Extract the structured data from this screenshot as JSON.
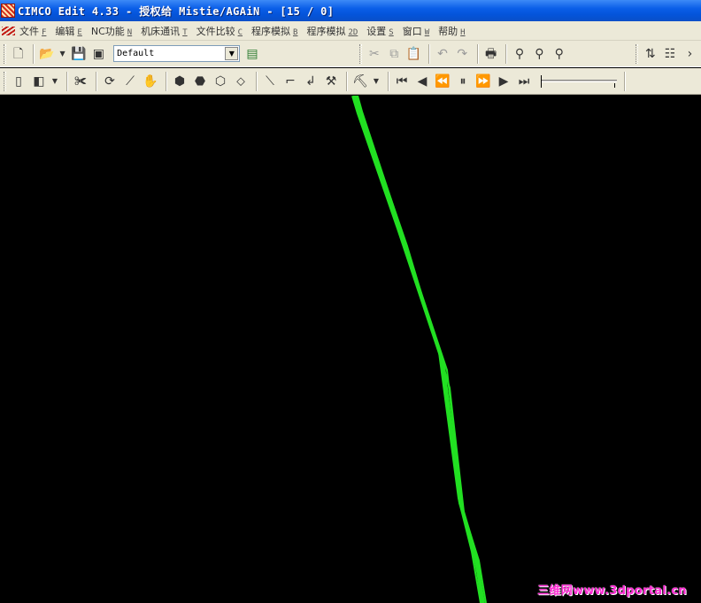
{
  "window": {
    "title": "CIMCO Edit 4.33 - 授权给 Mistie/AGAiN - [15 / 0]"
  },
  "menu": [
    {
      "label": "文件",
      "hotkey": "F"
    },
    {
      "label": "编辑",
      "hotkey": "E"
    },
    {
      "label": "NC功能",
      "hotkey": "N"
    },
    {
      "label": "机床通讯",
      "hotkey": "T"
    },
    {
      "label": "文件比较",
      "hotkey": "C"
    },
    {
      "label": "程序模拟",
      "hotkey": "B"
    },
    {
      "label": "程序模拟",
      "hotkey": "2D"
    },
    {
      "label": "设置",
      "hotkey": "S"
    },
    {
      "label": "窗口",
      "hotkey": "W"
    },
    {
      "label": "帮助",
      "hotkey": "H"
    }
  ],
  "toolbar": {
    "profile_value": "Default"
  },
  "toolpath": {
    "color": "#22e022"
  },
  "watermark": "三维网www.3dportal.cn"
}
